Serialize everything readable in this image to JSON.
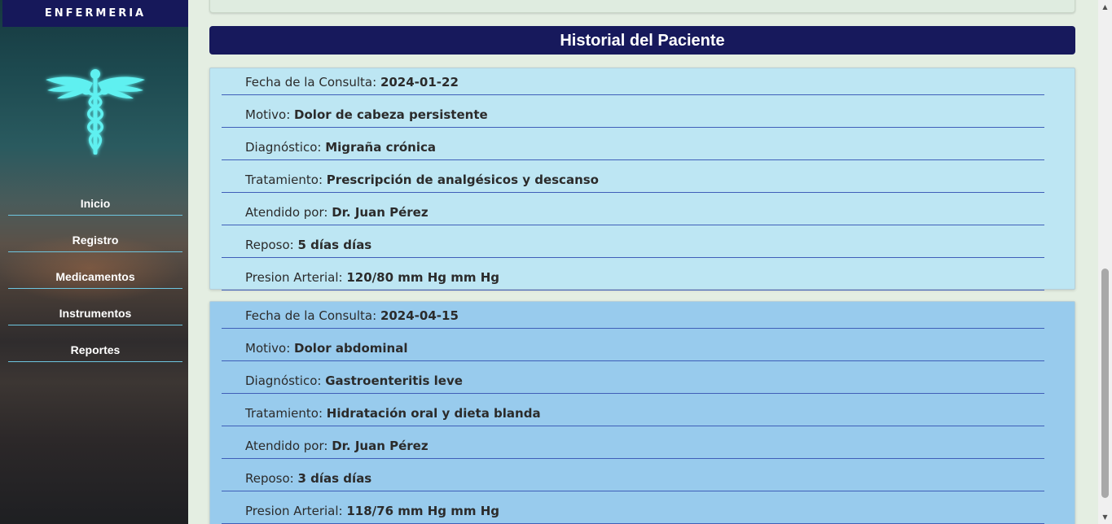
{
  "sidebar": {
    "brand": "ENFERMERIA",
    "logo_icon": "caduceus-icon",
    "logo_color": "#5ff0f0",
    "nav": [
      {
        "label": "Inicio"
      },
      {
        "label": "Registro"
      },
      {
        "label": "Medicamentos"
      },
      {
        "label": "Instrumentos"
      },
      {
        "label": "Reportes"
      }
    ]
  },
  "main": {
    "title": "Historial del Paciente",
    "records": [
      {
        "rows": [
          {
            "label": "Fecha de la Consulta: ",
            "value": "2024-01-22"
          },
          {
            "label": "Motivo: ",
            "value": "Dolor de cabeza persistente"
          },
          {
            "label": "Diagnóstico: ",
            "value": "Migraña crónica"
          },
          {
            "label": "Tratamiento: ",
            "value": "Prescripción de analgésicos y descanso"
          },
          {
            "label": "Atendido por: ",
            "value": "Dr. Juan Pérez"
          },
          {
            "label": "Reposo: ",
            "value": "5 días días"
          },
          {
            "label": "Presion Arterial: ",
            "value": "120/80 mm Hg mm Hg"
          }
        ]
      },
      {
        "rows": [
          {
            "label": "Fecha de la Consulta: ",
            "value": "2024-04-15"
          },
          {
            "label": "Motivo: ",
            "value": "Dolor abdominal"
          },
          {
            "label": "Diagnóstico: ",
            "value": "Gastroenteritis leve"
          },
          {
            "label": "Tratamiento: ",
            "value": "Hidratación oral y dieta blanda"
          },
          {
            "label": "Atendido por: ",
            "value": "Dr. Juan Pérez"
          },
          {
            "label": "Reposo: ",
            "value": "3 días días"
          },
          {
            "label": "Presion Arterial: ",
            "value": "118/76 mm Hg mm Hg"
          }
        ]
      }
    ]
  },
  "colors": {
    "header_bg": "#17195c",
    "record_1_bg": "#bde6f3",
    "record_2_bg": "#98cbed",
    "row_divider": "#3f5fb8"
  }
}
